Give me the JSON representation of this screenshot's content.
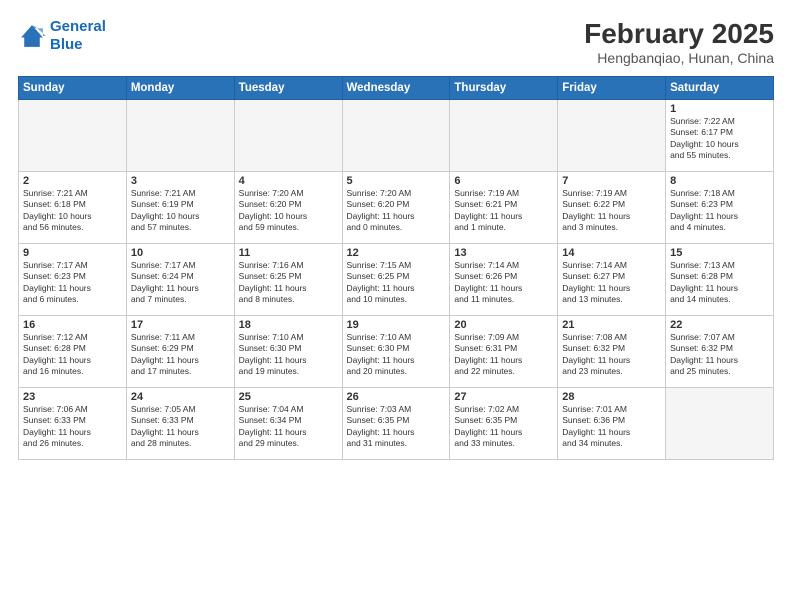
{
  "header": {
    "logo_line1": "General",
    "logo_line2": "Blue",
    "main_title": "February 2025",
    "sub_title": "Hengbanqiao, Hunan, China"
  },
  "weekdays": [
    "Sunday",
    "Monday",
    "Tuesday",
    "Wednesday",
    "Thursday",
    "Friday",
    "Saturday"
  ],
  "weeks": [
    [
      {
        "num": "",
        "info": ""
      },
      {
        "num": "",
        "info": ""
      },
      {
        "num": "",
        "info": ""
      },
      {
        "num": "",
        "info": ""
      },
      {
        "num": "",
        "info": ""
      },
      {
        "num": "",
        "info": ""
      },
      {
        "num": "1",
        "info": "Sunrise: 7:22 AM\nSunset: 6:17 PM\nDaylight: 10 hours\nand 55 minutes."
      }
    ],
    [
      {
        "num": "2",
        "info": "Sunrise: 7:21 AM\nSunset: 6:18 PM\nDaylight: 10 hours\nand 56 minutes."
      },
      {
        "num": "3",
        "info": "Sunrise: 7:21 AM\nSunset: 6:19 PM\nDaylight: 10 hours\nand 57 minutes."
      },
      {
        "num": "4",
        "info": "Sunrise: 7:20 AM\nSunset: 6:20 PM\nDaylight: 10 hours\nand 59 minutes."
      },
      {
        "num": "5",
        "info": "Sunrise: 7:20 AM\nSunset: 6:20 PM\nDaylight: 11 hours\nand 0 minutes."
      },
      {
        "num": "6",
        "info": "Sunrise: 7:19 AM\nSunset: 6:21 PM\nDaylight: 11 hours\nand 1 minute."
      },
      {
        "num": "7",
        "info": "Sunrise: 7:19 AM\nSunset: 6:22 PM\nDaylight: 11 hours\nand 3 minutes."
      },
      {
        "num": "8",
        "info": "Sunrise: 7:18 AM\nSunset: 6:23 PM\nDaylight: 11 hours\nand 4 minutes."
      }
    ],
    [
      {
        "num": "9",
        "info": "Sunrise: 7:17 AM\nSunset: 6:23 PM\nDaylight: 11 hours\nand 6 minutes."
      },
      {
        "num": "10",
        "info": "Sunrise: 7:17 AM\nSunset: 6:24 PM\nDaylight: 11 hours\nand 7 minutes."
      },
      {
        "num": "11",
        "info": "Sunrise: 7:16 AM\nSunset: 6:25 PM\nDaylight: 11 hours\nand 8 minutes."
      },
      {
        "num": "12",
        "info": "Sunrise: 7:15 AM\nSunset: 6:25 PM\nDaylight: 11 hours\nand 10 minutes."
      },
      {
        "num": "13",
        "info": "Sunrise: 7:14 AM\nSunset: 6:26 PM\nDaylight: 11 hours\nand 11 minutes."
      },
      {
        "num": "14",
        "info": "Sunrise: 7:14 AM\nSunset: 6:27 PM\nDaylight: 11 hours\nand 13 minutes."
      },
      {
        "num": "15",
        "info": "Sunrise: 7:13 AM\nSunset: 6:28 PM\nDaylight: 11 hours\nand 14 minutes."
      }
    ],
    [
      {
        "num": "16",
        "info": "Sunrise: 7:12 AM\nSunset: 6:28 PM\nDaylight: 11 hours\nand 16 minutes."
      },
      {
        "num": "17",
        "info": "Sunrise: 7:11 AM\nSunset: 6:29 PM\nDaylight: 11 hours\nand 17 minutes."
      },
      {
        "num": "18",
        "info": "Sunrise: 7:10 AM\nSunset: 6:30 PM\nDaylight: 11 hours\nand 19 minutes."
      },
      {
        "num": "19",
        "info": "Sunrise: 7:10 AM\nSunset: 6:30 PM\nDaylight: 11 hours\nand 20 minutes."
      },
      {
        "num": "20",
        "info": "Sunrise: 7:09 AM\nSunset: 6:31 PM\nDaylight: 11 hours\nand 22 minutes."
      },
      {
        "num": "21",
        "info": "Sunrise: 7:08 AM\nSunset: 6:32 PM\nDaylight: 11 hours\nand 23 minutes."
      },
      {
        "num": "22",
        "info": "Sunrise: 7:07 AM\nSunset: 6:32 PM\nDaylight: 11 hours\nand 25 minutes."
      }
    ],
    [
      {
        "num": "23",
        "info": "Sunrise: 7:06 AM\nSunset: 6:33 PM\nDaylight: 11 hours\nand 26 minutes."
      },
      {
        "num": "24",
        "info": "Sunrise: 7:05 AM\nSunset: 6:33 PM\nDaylight: 11 hours\nand 28 minutes."
      },
      {
        "num": "25",
        "info": "Sunrise: 7:04 AM\nSunset: 6:34 PM\nDaylight: 11 hours\nand 29 minutes."
      },
      {
        "num": "26",
        "info": "Sunrise: 7:03 AM\nSunset: 6:35 PM\nDaylight: 11 hours\nand 31 minutes."
      },
      {
        "num": "27",
        "info": "Sunrise: 7:02 AM\nSunset: 6:35 PM\nDaylight: 11 hours\nand 33 minutes."
      },
      {
        "num": "28",
        "info": "Sunrise: 7:01 AM\nSunset: 6:36 PM\nDaylight: 11 hours\nand 34 minutes."
      },
      {
        "num": "",
        "info": ""
      }
    ]
  ]
}
